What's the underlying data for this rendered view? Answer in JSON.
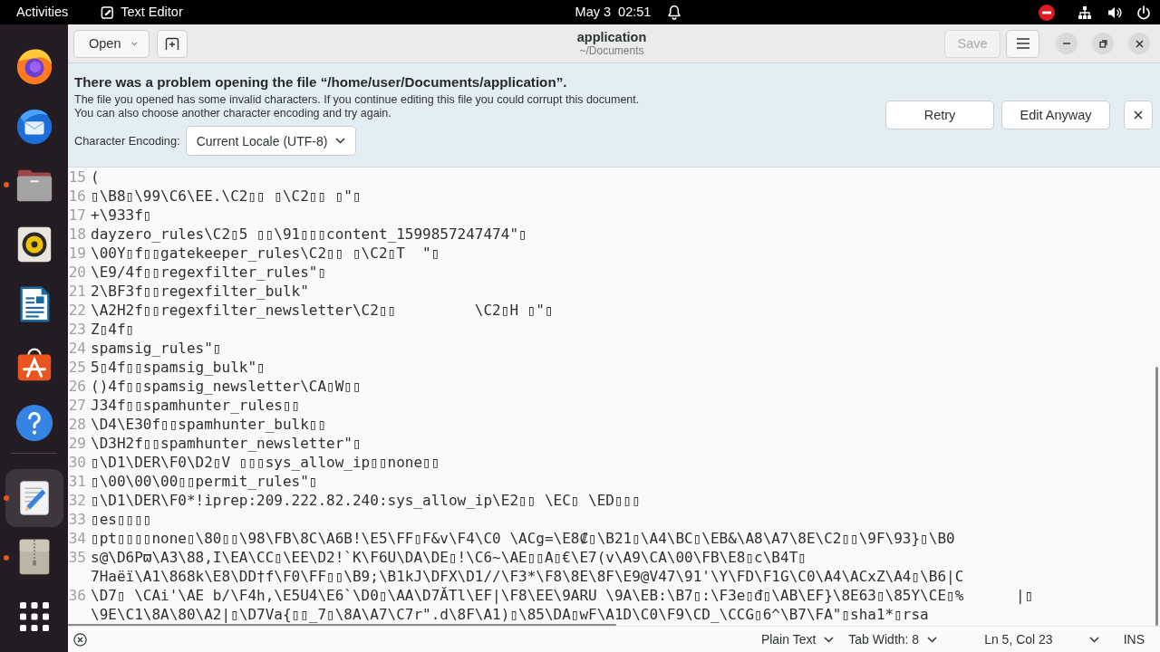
{
  "top_bar": {
    "activities": "Activities",
    "app_name": "Text Editor",
    "clock": "May 3  02:51"
  },
  "dock": {
    "favorites": [
      {
        "kind": "browser",
        "running": false,
        "selected": false
      },
      {
        "kind": "mail",
        "running": false,
        "selected": false
      },
      {
        "kind": "files",
        "running": true,
        "selected": false
      },
      {
        "kind": "music",
        "running": false,
        "selected": false
      },
      {
        "kind": "writer",
        "running": false,
        "selected": false
      },
      {
        "kind": "store",
        "running": false,
        "selected": false
      },
      {
        "kind": "help",
        "running": false,
        "selected": false
      }
    ],
    "others": [
      {
        "kind": "editor",
        "running": true,
        "selected": true
      },
      {
        "kind": "archive",
        "running": true,
        "selected": false
      }
    ]
  },
  "header": {
    "open_button": "Open",
    "title": "application",
    "subtitle": "~/Documents",
    "save_button": {
      "label": "Save",
      "disabled": true
    }
  },
  "infobar": {
    "title": "There was a problem opening the file “/home/user/Documents/application”.",
    "message": [
      "The file you opened has some invalid characters. If you continue editing this file you could corrupt this document.",
      "You can also choose another character encoding and try again."
    ],
    "encoding_label": "Character Encoding:",
    "encoding_value": "Current Locale (UTF-8)",
    "retry_button": "Retry",
    "edit_anyway_button": "Edit Anyway"
  },
  "editor": {
    "lines": [
      {
        "number": "15",
        "segments": [
          "("
        ]
      },
      {
        "number": "16",
        "segments": [
          "▯\\B8▯\\99\\C6\\EE.\\C2▯▯ ▯\\C2▯▯ ▯\"▯"
        ]
      },
      {
        "number": "17",
        "segments": [
          "+\\933f▯"
        ]
      },
      {
        "number": "18",
        "segments": [
          "dayzero_rules\\C2▯5 ▯▯\\91▯▯▯content_1599857247474\"▯"
        ]
      },
      {
        "number": "19",
        "segments": [
          "\\00Y▯f▯▯gatekeeper_rules\\C2▯▯ ▯\\C2▯T  \"▯"
        ]
      },
      {
        "number": "20",
        "segments": [
          "\\E9/4f▯▯regexfilter_rules\"▯"
        ]
      },
      {
        "number": "21",
        "segments": [
          "2\\BF3f▯▯regexfilter_bulk\""
        ]
      },
      {
        "number": "22",
        "segments": [
          "\\A2H2f▯▯regexfilter_newsletter\\C2▯▯         \\C2▯H ▯\"▯"
        ]
      },
      {
        "number": "23",
        "segments": [
          "Z▯4f▯"
        ]
      },
      {
        "number": "24",
        "segments": [
          "spamsig_rules\"▯"
        ]
      },
      {
        "number": "25",
        "segments": [
          "5▯4f▯▯spamsig_bulk\"▯"
        ]
      },
      {
        "number": "26",
        "segments": [
          "()4f▯▯spamsig_newsletter\\CA▯W▯▯"
        ]
      },
      {
        "number": "27",
        "segments": [
          "J34f▯▯spamhunter_rules▯▯"
        ]
      },
      {
        "number": "28",
        "segments": [
          "\\D4\\E30f▯▯spamhunter_bulk▯▯"
        ]
      },
      {
        "number": "29",
        "segments": [
          "\\D3H2f▯▯spamhunter_newsletter\"▯"
        ]
      },
      {
        "number": "30",
        "segments": [
          "▯\\D1\\DER\\F0\\D2▯V ▯▯▯sys_allow_ip▯▯none▯▯"
        ]
      },
      {
        "number": "31",
        "segments": [
          "▯\\00\\00\\00▯▯permit_rules\"▯"
        ]
      },
      {
        "number": "32",
        "segments": [
          "▯\\D1\\DER\\F0*!iprep:209.222.82.240:sys_allow_ip\\E2▯▯ \\EC▯ \\ED▯▯▯"
        ]
      },
      {
        "number": "33",
        "segments": [
          "▯es▯▯▯▯"
        ]
      },
      {
        "number": "34",
        "segments": [
          "▯pt▯▯▯▯none▯\\80▯▯\\98\\FB\\8C\\A6B!\\E5\\FF▯F&v\\F4\\C0 \\ACg=\\E8₡▯\\B21▯\\A4\\BC▯\\EB&\\A8\\A7\\8E\\C2▯▯\\9F\\93}▯\\B0"
        ]
      },
      {
        "number": "35",
        "segments": [
          "s@\\D6Pϖ\\A3\\88,I\\EA\\CC▯\\EE\\D2!`K\\F6U\\DA\\DE▯!\\C6~\\AE▯▯A▯€\\E7(v\\A9\\CA\\00\\FB\\E8▯c\\B4T▯",
          "7Haëï\\A1\\868k\\E8\\DD†f\\F0\\FF▯▯\\B9;\\B1kJ\\DFX\\D1//\\F3*\\F8\\8E\\8F\\E9@V47\\91'\\Y\\FD\\F1G\\C0\\A4\\ACxZ\\A4▯\\B6|C"
        ]
      },
      {
        "number": "36",
        "segments": [
          "\\D7▯ \\CAi'\\AE b/\\F4h,\\E5U4\\E6`\\D0▯\\AA\\D7ĂTl\\EF|\\F8\\EE\\9ARU \\9A\\EB:\\B7▯:\\F3e▯đ▯\\AB\\EF}\\8E63▯\\85Y\\CE▯%      |▯",
          "\\9E\\C1\\8A\\80\\A2|▯\\D7Va{▯▯_7▯\\8A\\A7\\C7r\".d\\8F\\A1)▯\\85\\DA▯wF\\A1D\\C0\\F9\\CD_\\CCG▯6^\\B7\\FA\"▯sha1*▯rsa"
        ]
      }
    ]
  },
  "status_bar": {
    "language": "Plain Text",
    "tab_width": "Tab Width: 8",
    "position": "Ln 5, Col 23",
    "mode": "INS"
  }
}
